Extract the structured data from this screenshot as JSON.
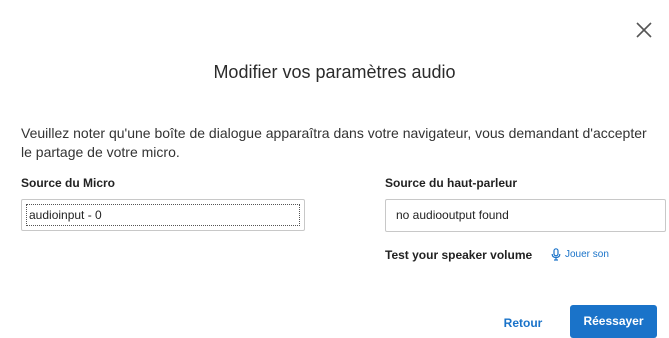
{
  "dialog": {
    "title": "Modifier vos paramètres audio",
    "notice": "Veuillez noter qu'une boîte de dialogue apparaîtra dans votre navigateur, vous demandant d'accepter le partage de votre micro.",
    "close_icon": "close-icon"
  },
  "microphone": {
    "label": "Source du Micro",
    "selected": "audioinput - 0"
  },
  "speaker": {
    "label": "Source du haut-parleur",
    "selected": "no audiooutput found",
    "test_label": "Test your speaker volume",
    "play_label": "Jouer son",
    "play_icon": "microphone-icon"
  },
  "actions": {
    "back_label": "Retour",
    "retry_label": "Réessayer"
  },
  "colors": {
    "accent": "#1a73c9",
    "text": "#2b2b2b",
    "border": "#c8c8c8"
  }
}
